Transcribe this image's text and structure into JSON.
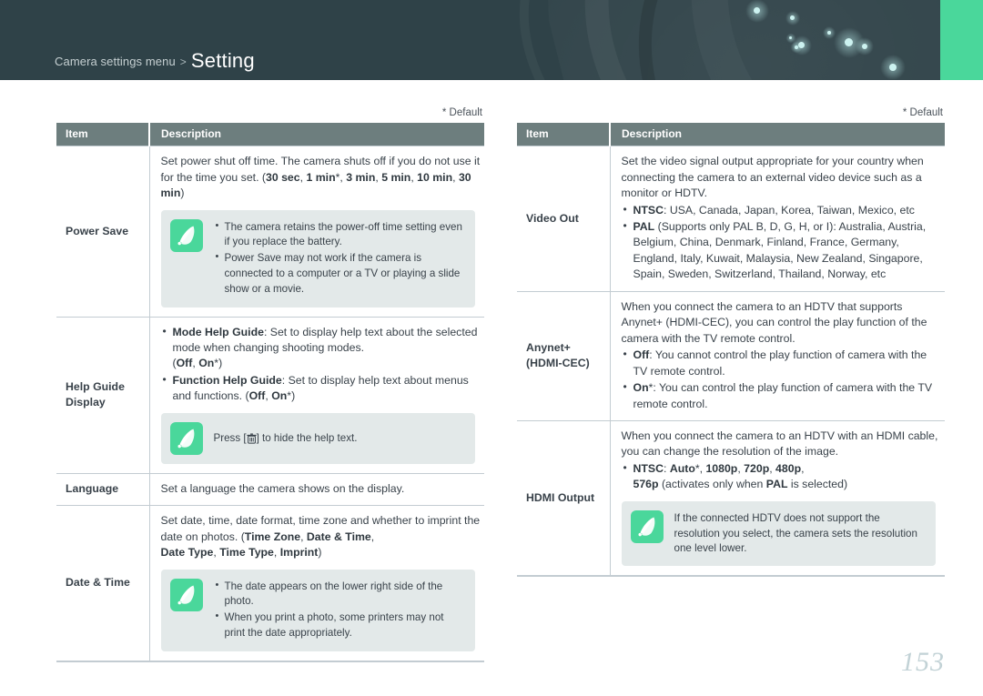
{
  "header": {
    "breadcrumb_prefix": "Camera settings menu",
    "breadcrumb_separator": ">",
    "breadcrumb_current": "Setting",
    "accent_color": "#4ad79b",
    "background_color": "#2f4248"
  },
  "page_number": "153",
  "left_table": {
    "default_note": "* Default",
    "columns": [
      "Item",
      "Description"
    ],
    "rows": [
      {
        "item": "Power Save",
        "paragraphs": [
          "Set power shut off time. The camera shuts off if you do not use it for the time you set. (30 sec, 1 min*, 3 min, 5 min, 10 min, 30 min)"
        ],
        "note": {
          "icon": "note-pen-icon",
          "bullets": [
            "The camera retains the power-off time setting even if you replace the battery.",
            "Power Save may not work if the camera is connected to a computer or a TV or playing a slide show or a movie."
          ]
        }
      },
      {
        "item": "Help Guide Display",
        "bullets": [
          "Mode Help Guide: Set to display help text about the selected mode when changing shooting modes. (Off, On*)",
          "Function Help Guide: Set to display help text about menus and functions. (Off, On*)"
        ],
        "note": {
          "icon": "note-pen-icon",
          "text_before": "Press [",
          "key_icon": "trash-icon",
          "text_after": "] to hide the help text."
        }
      },
      {
        "item": "Language",
        "paragraphs": [
          "Set a language the camera shows on the display."
        ]
      },
      {
        "item": "Date & Time",
        "paragraphs": [
          "Set date, time, date format, time zone and whether to imprint the date on photos. (Time Zone, Date & Time, Date Type, Time Type, Imprint)"
        ],
        "note": {
          "icon": "note-pen-icon",
          "bullets": [
            "The date appears on the lower right side of the photo.",
            "When you print a photo, some printers may not print the date appropriately."
          ]
        }
      }
    ]
  },
  "right_table": {
    "default_note": "* Default",
    "columns": [
      "Item",
      "Description"
    ],
    "rows": [
      {
        "item": "Video Out",
        "paragraphs": [
          "Set the video signal output appropriate for your country when connecting the camera to an external video device such as a monitor or HDTV."
        ],
        "bullets": [
          "NTSC: USA, Canada, Japan, Korea, Taiwan, Mexico, etc",
          "PAL (Supports only PAL B, D, G, H, or I): Australia, Austria, Belgium, China, Denmark, Finland, France, Germany, England, Italy, Kuwait, Malaysia, New Zealand, Singapore, Spain, Sweden, Switzerland, Thailand, Norway, etc"
        ]
      },
      {
        "item": "Anynet+ (HDMI-CEC)",
        "item_line1": "Anynet+",
        "item_line2": "(HDMI-CEC)",
        "paragraphs": [
          "When you connect the camera to an HDTV that supports Anynet+ (HDMI-CEC), you can control the play function of the camera with the TV remote control."
        ],
        "bullets": [
          "Off: You cannot control the play function of camera with the TV remote control.",
          "On*: You can control the play function of camera with the TV remote control."
        ]
      },
      {
        "item": "HDMI Output",
        "paragraphs": [
          "When you connect the camera to an HDTV with an HDMI cable, you can change the resolution of the image."
        ],
        "bullets": [
          "NTSC: Auto*, 1080p, 720p, 480p, 576p (activates only when PAL is selected)"
        ],
        "note": {
          "icon": "note-pen-icon",
          "text": "If the connected HDTV does not support the resolution you select, the camera sets the resolution one level lower."
        }
      }
    ]
  }
}
